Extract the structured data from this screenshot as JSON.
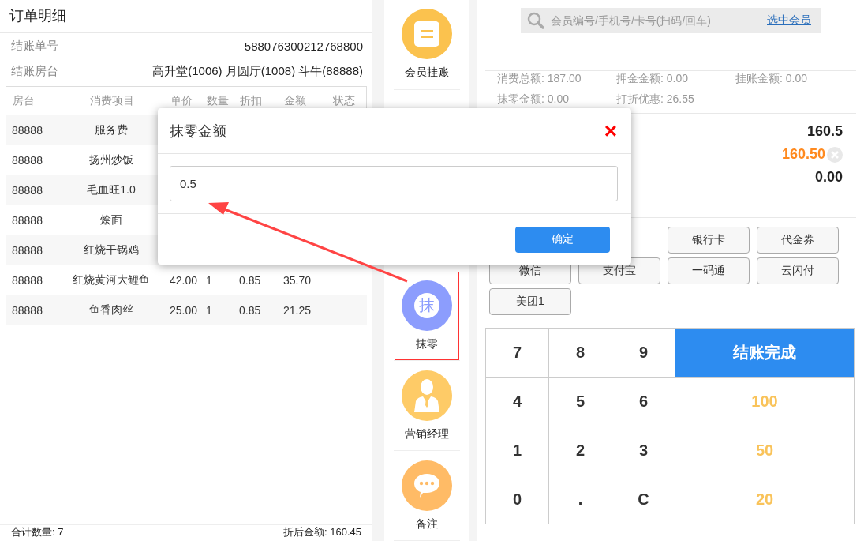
{
  "order": {
    "title": "订单明细",
    "info": [
      {
        "label": "结账单号",
        "value": "588076300212768800"
      },
      {
        "label": "结账房台",
        "value": "高升堂(1006) 月圆厅(1008) 斗牛(88888)"
      }
    ],
    "columns": [
      "房台",
      "消费项目",
      "单价",
      "数量",
      "折扣",
      "金额",
      "状态"
    ],
    "rows": [
      {
        "cells": [
          "88888",
          "服务费"
        ]
      },
      {
        "cells": [
          "88888",
          "扬州炒饭"
        ]
      },
      {
        "cells": [
          "88888",
          "毛血旺1.0"
        ]
      },
      {
        "cells": [
          "88888",
          "烩面"
        ]
      },
      {
        "cells": [
          "88888",
          "红烧干锅鸡"
        ]
      },
      {
        "cells": [
          "88888",
          "红烧黄河大鲤鱼",
          "42.00",
          "1",
          "0.85",
          "35.70"
        ]
      },
      {
        "cells": [
          "88888",
          "鱼香肉丝",
          "25.00",
          "1",
          "0.85",
          "21.25"
        ]
      }
    ],
    "footer": [
      "合计数量: 7",
      "折后金额: 160.45"
    ]
  },
  "actions": [
    {
      "label": "会员挂账",
      "kind": "list",
      "color": "#fbc24e",
      "highlighted": false
    },
    {
      "label": "抹零",
      "kind": "glyph",
      "glyph": "抹",
      "color": "#8c9dfd",
      "highlighted": true
    },
    {
      "label": "营销经理",
      "kind": "person",
      "color": "#fecb67",
      "highlighted": false
    },
    {
      "label": "备注",
      "kind": "chat",
      "color": "#ffbb66",
      "highlighted": false
    }
  ],
  "member_search": {
    "placeholder": "会员编号/手机号/卡号(扫码/回车)",
    "link": "选中会员"
  },
  "summary": [
    "消费总额: 187.00",
    "押金金额: 0.00",
    "挂账金额: 0.00",
    "抹零金额: 0.00",
    "打折优惠: 26.55"
  ],
  "amounts": [
    {
      "value": "160.5",
      "kind": "plain"
    },
    {
      "value": "160.50",
      "kind": "editable"
    },
    {
      "value": "0.00",
      "kind": "plain"
    }
  ],
  "payment_methods": [
    "银行卡",
    "代金券",
    "微信",
    "支付宝",
    "一码通",
    "云闪付",
    "美团1"
  ],
  "keypad": [
    {
      "label": "7",
      "kind": "digit"
    },
    {
      "label": "8",
      "kind": "digit"
    },
    {
      "label": "9",
      "kind": "digit"
    },
    {
      "label": "结账完成",
      "kind": "submit"
    },
    {
      "label": "4",
      "kind": "digit"
    },
    {
      "label": "5",
      "kind": "digit"
    },
    {
      "label": "6",
      "kind": "digit"
    },
    {
      "label": "100",
      "kind": "quick"
    },
    {
      "label": "1",
      "kind": "digit"
    },
    {
      "label": "2",
      "kind": "digit"
    },
    {
      "label": "3",
      "kind": "digit"
    },
    {
      "label": "50",
      "kind": "quick"
    },
    {
      "label": "0",
      "kind": "digit"
    },
    {
      "label": ".",
      "kind": "digit"
    },
    {
      "label": "C",
      "kind": "digit"
    },
    {
      "label": "20",
      "kind": "quick"
    }
  ],
  "dialog": {
    "title": "抹零金额",
    "close": "×",
    "value": "0.5",
    "confirm": "确定"
  }
}
